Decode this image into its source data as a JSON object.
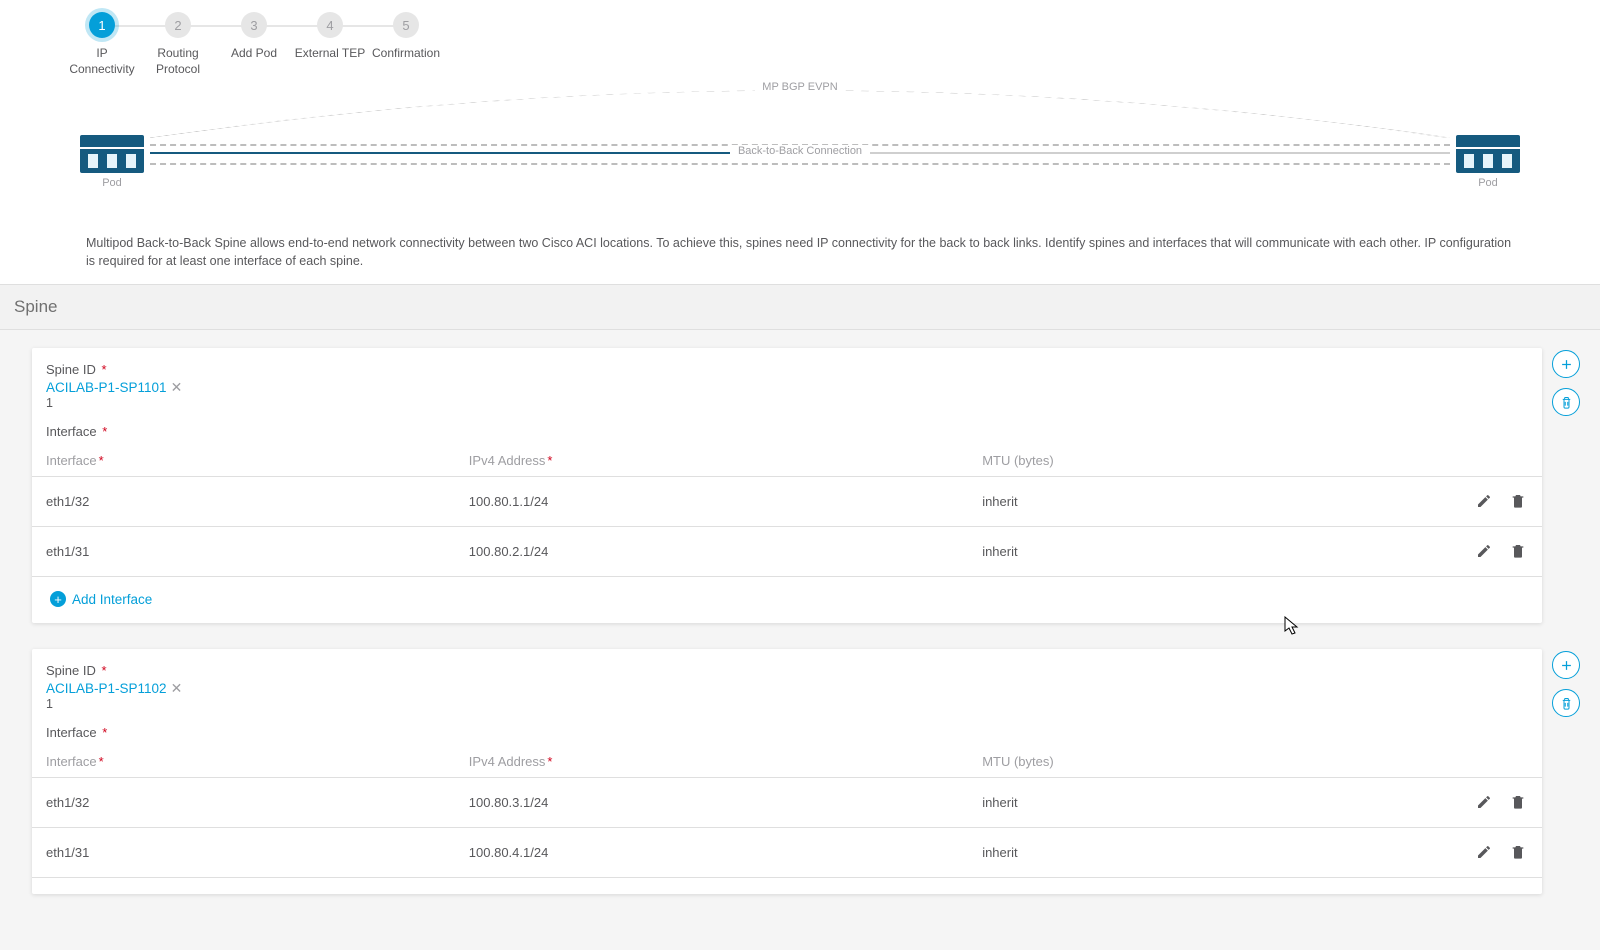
{
  "stepper": {
    "steps": [
      {
        "num": "1",
        "label": "IP Connectivity",
        "active": true
      },
      {
        "num": "2",
        "label": "Routing Protocol",
        "active": false
      },
      {
        "num": "3",
        "label": "Add Pod",
        "active": false
      },
      {
        "num": "4",
        "label": "External TEP",
        "active": false
      },
      {
        "num": "5",
        "label": "Confirmation",
        "active": false
      }
    ]
  },
  "diagram": {
    "mp_label": "MP BGP EVPN",
    "conn_label": "Back-to-Back Connection",
    "pod_left": "Pod",
    "pod_right": "Pod"
  },
  "description": "Multipod Back-to-Back Spine allows end-to-end network connectivity between two Cisco ACI locations. To achieve this, spines need IP connectivity for the back to back links. Identify spines and interfaces that will communicate with each other. IP configuration is required for at least one interface of each spine.",
  "spine_section_title": "Spine",
  "labels": {
    "spine_id": "Spine ID",
    "interface_section": "Interface",
    "col_interface": "Interface",
    "col_ipv4": "IPv4 Address",
    "col_mtu": "MTU (bytes)",
    "add_interface": "Add Interface"
  },
  "spines": [
    {
      "name": "ACILAB-P1-SP1101",
      "sub": "1",
      "interfaces": [
        {
          "if": "eth1/32",
          "ip": "100.80.1.1/24",
          "mtu": "inherit"
        },
        {
          "if": "eth1/31",
          "ip": "100.80.2.1/24",
          "mtu": "inherit"
        }
      ]
    },
    {
      "name": "ACILAB-P1-SP1102",
      "sub": "1",
      "interfaces": [
        {
          "if": "eth1/32",
          "ip": "100.80.3.1/24",
          "mtu": "inherit"
        },
        {
          "if": "eth1/31",
          "ip": "100.80.4.1/24",
          "mtu": "inherit"
        }
      ]
    }
  ]
}
